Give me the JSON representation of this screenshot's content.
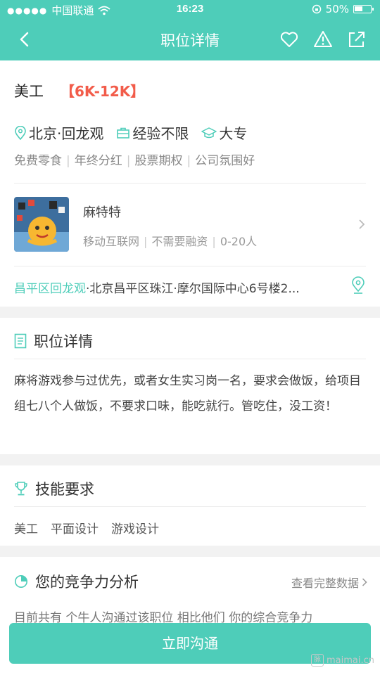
{
  "status_bar": {
    "carrier": "中国联通",
    "time": "16:23",
    "battery": "50%",
    "battery_level": 0.5
  },
  "nav": {
    "title": "职位详情",
    "icons": [
      "back-arrow-icon",
      "heart-icon",
      "warning-icon",
      "share-icon"
    ]
  },
  "job": {
    "title": "美工",
    "salary": "【6K-12K】",
    "location": "北京·回龙观",
    "experience": "经验不限",
    "education": "大专",
    "tags": [
      "免费零食",
      "年终分红",
      "股票期权",
      "公司氛围好"
    ]
  },
  "company": {
    "name": "麻特特",
    "industry": "移动互联网",
    "funding": "不需要融资",
    "size": "0-20人",
    "address_highlight": "昌平区回龙观",
    "address_rest": "·北京昌平区珠江·摩尔国际中心6号楼2..."
  },
  "description": {
    "heading": "职位详情",
    "text": "麻将游戏参与过优先，或者女生实习岗一名，要求会做饭，给项目组七八个人做饭，不要求口味，能吃就行。管吃住，没工资！"
  },
  "skills": {
    "heading": "技能要求",
    "items": [
      "美工",
      "平面设计",
      "游戏设计"
    ]
  },
  "competitiveness": {
    "heading": "您的竞争力分析",
    "more_link": "查看完整数据",
    "overflow_text": "目前共有 个牛人沟通过该职位 相比他们 你的综合竞争力"
  },
  "cta": {
    "label": "立即沟通"
  },
  "watermark": "maimai.cn",
  "colors": {
    "accent": "#4ecdb9",
    "salary": "#f25c4a"
  }
}
